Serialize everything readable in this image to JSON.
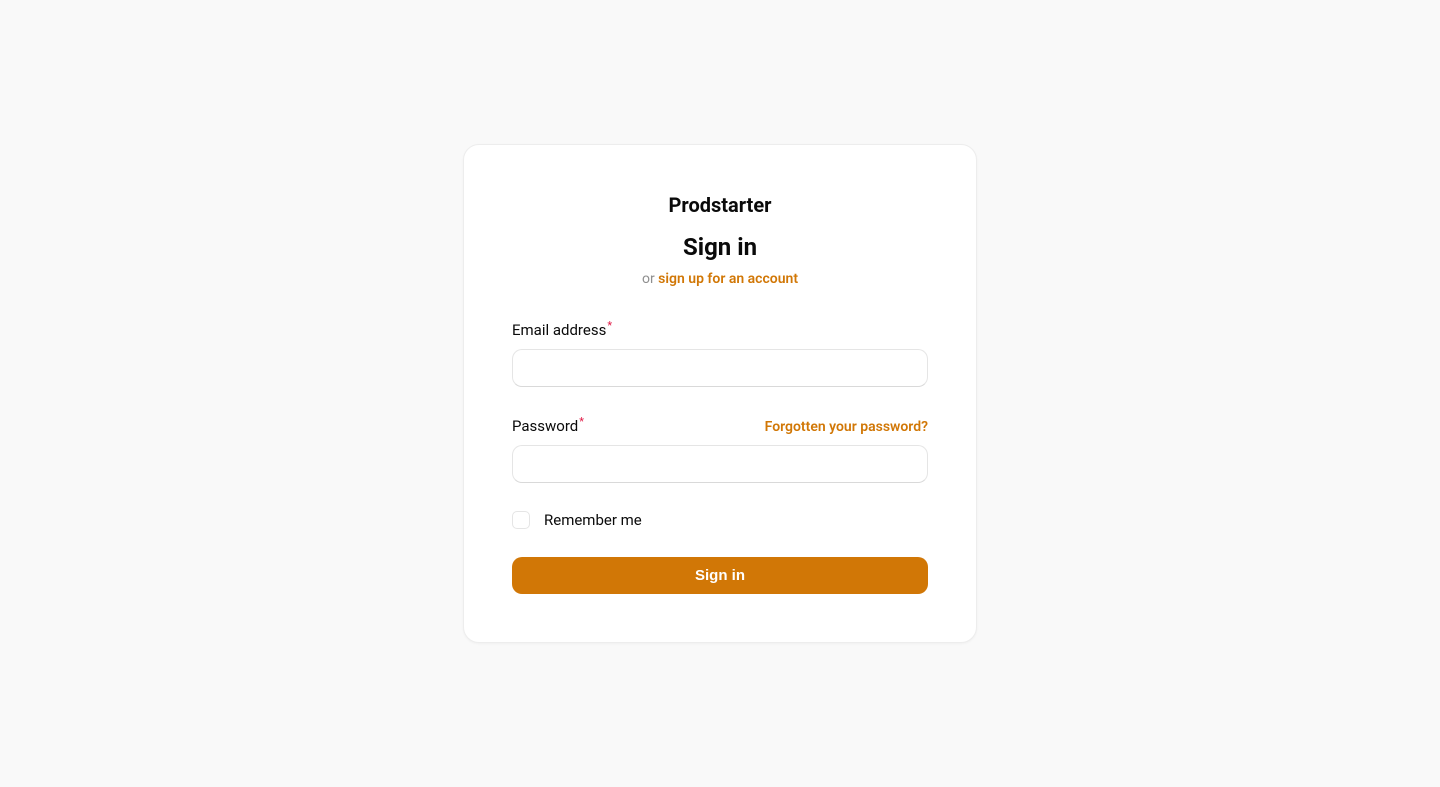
{
  "brand": "Prodstarter",
  "title": "Sign in",
  "subline_prefix": "or ",
  "signup_link_text": "sign up for an account",
  "email": {
    "label": "Email address",
    "value": ""
  },
  "password": {
    "label": "Password",
    "value": "",
    "forgot_text": "Forgotten your password?"
  },
  "remember": {
    "label": "Remember me"
  },
  "submit_label": "Sign in"
}
